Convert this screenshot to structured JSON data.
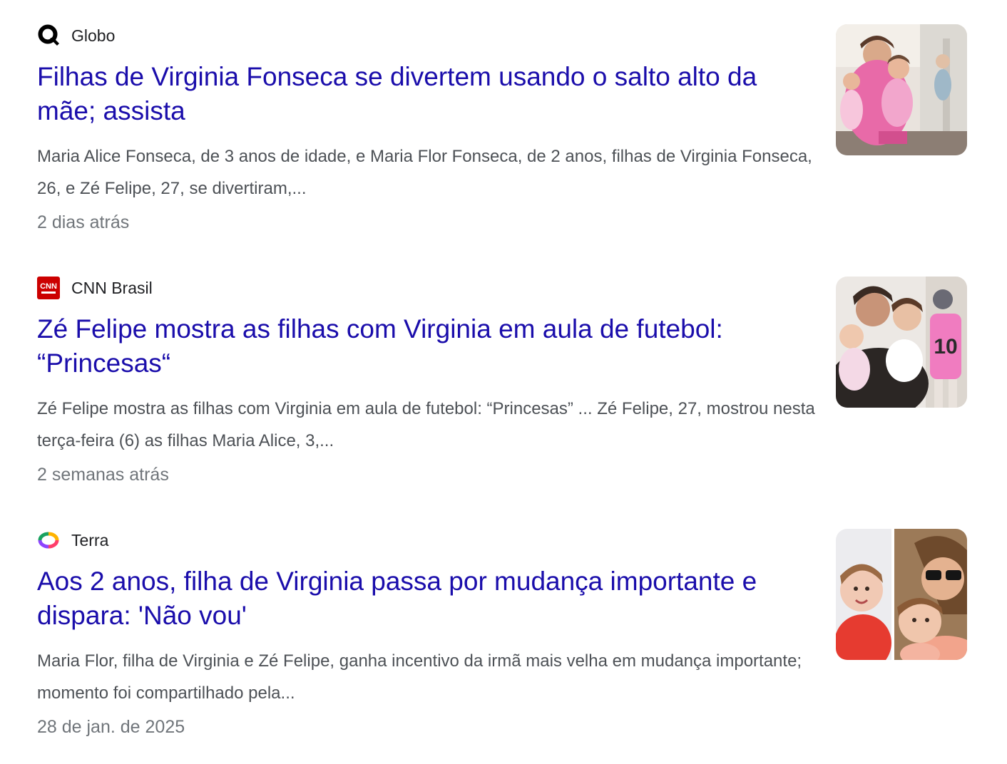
{
  "results": [
    {
      "source": "Globo",
      "source_icon": "globo-q-logo-icon",
      "headline": "Filhas de Virginia Fonseca se divertem usando o salto alto da mãe; assista",
      "snippet": "Maria Alice Fonseca, de 3 anos de idade, e Maria Flor Fonseca, de 2 anos, filhas de Virginia Fonseca, 26, e Zé Felipe, 27, se divertiram,...",
      "age": "2 dias atrás",
      "thumbnail": "photo of two young girls in pink dresses with a woman"
    },
    {
      "source": "CNN Brasil",
      "source_icon": "cnn-logo-icon",
      "headline": "Zé Felipe mostra as filhas com Virginia em aula de futebol: “Princesas“",
      "snippet": "Zé Felipe mostra as filhas com Virginia em aula de futebol: “Princesas” ... Zé Felipe, 27, mostrou nesta terça-feira (6) as filhas Maria Alice, 3,...",
      "age": "2 semanas atrás",
      "thumbnail": "photo of a man hugging two young girls, girl in pink number 10 jersey"
    },
    {
      "source": "Terra",
      "source_icon": "terra-logo-icon",
      "headline": "Aos 2 anos, filha de Virginia passa por mudança importante e dispara: 'Não vou'",
      "snippet": "Maria Flor, filha de Virginia e Zé Felipe, ganha incentivo da irmã mais velha em mudança importante; momento foi compartilhado pela...",
      "age": "28 de jan. de 2025",
      "thumbnail": "photo collage of a young girl and a woman in sunglasses"
    }
  ],
  "colors": {
    "headline_link": "#1a0dab",
    "snippet_text": "#4d5156",
    "meta_text": "#70757a",
    "source_text": "#202124",
    "cnn_red": "#cc0000"
  }
}
